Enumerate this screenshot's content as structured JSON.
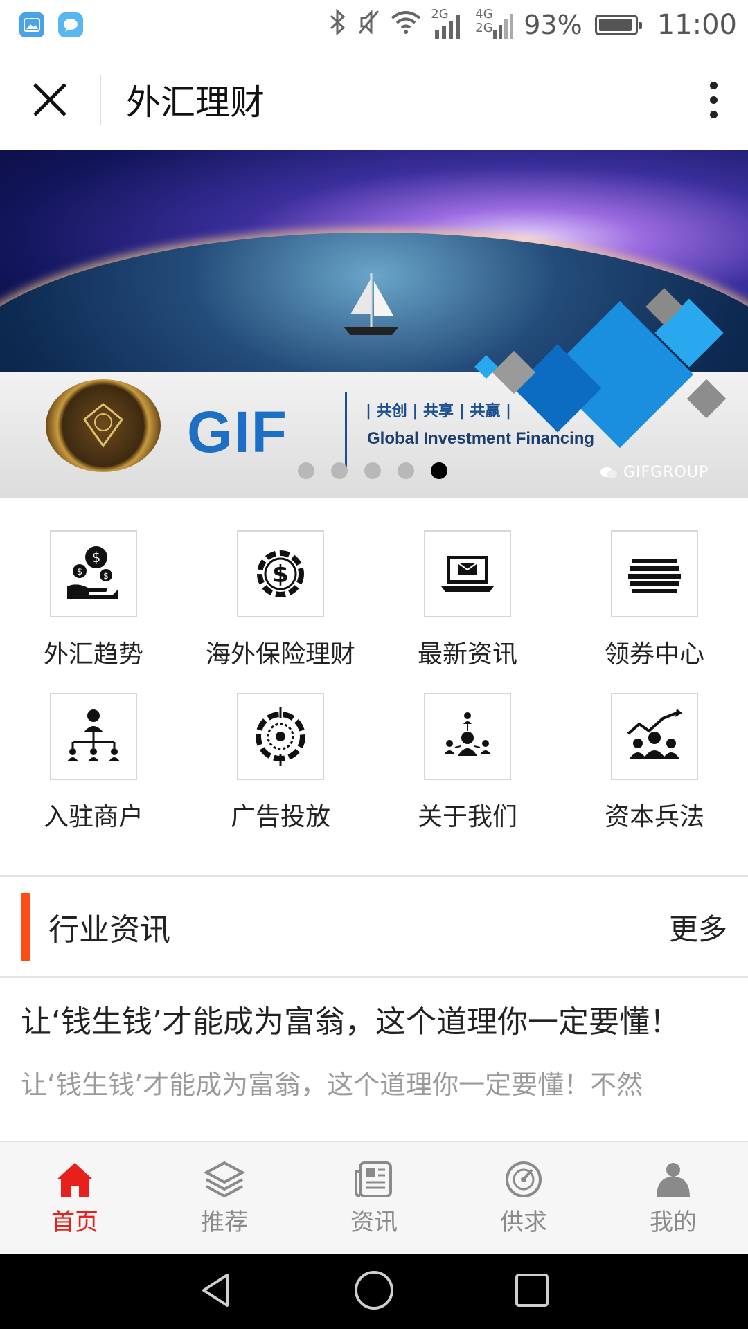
{
  "status_bar": {
    "network_2g": "2G",
    "network_4g": "4G",
    "network_2g_b": "2G",
    "battery_percent": "93%",
    "battery_level": 0.93,
    "time": "11:00"
  },
  "title_bar": {
    "title": "外汇理财"
  },
  "banner": {
    "brand": "GIF",
    "slogan": "| 共创 | 共享 | 共赢 |",
    "subtitle": "Global Investment Financing",
    "watermark": "GIFGROUP",
    "slide_count": 5,
    "active_slide": 5
  },
  "menu": {
    "items": [
      {
        "label": "外汇趋势",
        "icon": "money-hand-icon"
      },
      {
        "label": "海外保险理财",
        "icon": "dollar-gear-icon"
      },
      {
        "label": "最新资讯",
        "icon": "laptop-mail-icon"
      },
      {
        "label": "领券中心",
        "icon": "stack-icon"
      },
      {
        "label": "入驻商户",
        "icon": "org-chart-icon"
      },
      {
        "label": "广告投放",
        "icon": "target-gear-icon"
      },
      {
        "label": "关于我们",
        "icon": "team-icon"
      },
      {
        "label": "资本兵法",
        "icon": "growth-team-icon"
      }
    ]
  },
  "section": {
    "title": "行业资讯",
    "more": "更多"
  },
  "article": {
    "title": "让‘钱生钱’才能成为富翁，这个道理你一定要懂！",
    "desc": "让‘钱生钱’才能成为富翁，这个道理你一定要懂！不然"
  },
  "tabbar": {
    "tabs": [
      {
        "label": "首页",
        "icon": "home-icon",
        "active": true
      },
      {
        "label": "推荐",
        "icon": "layers-icon",
        "active": false
      },
      {
        "label": "资讯",
        "icon": "news-icon",
        "active": false
      },
      {
        "label": "供求",
        "icon": "gauge-icon",
        "active": false
      },
      {
        "label": "我的",
        "icon": "person-icon",
        "active": false
      }
    ]
  },
  "colors": {
    "accent": "#ff4b14",
    "tab_active": "#e8201b",
    "brand_blue": "#1c6fc4"
  }
}
